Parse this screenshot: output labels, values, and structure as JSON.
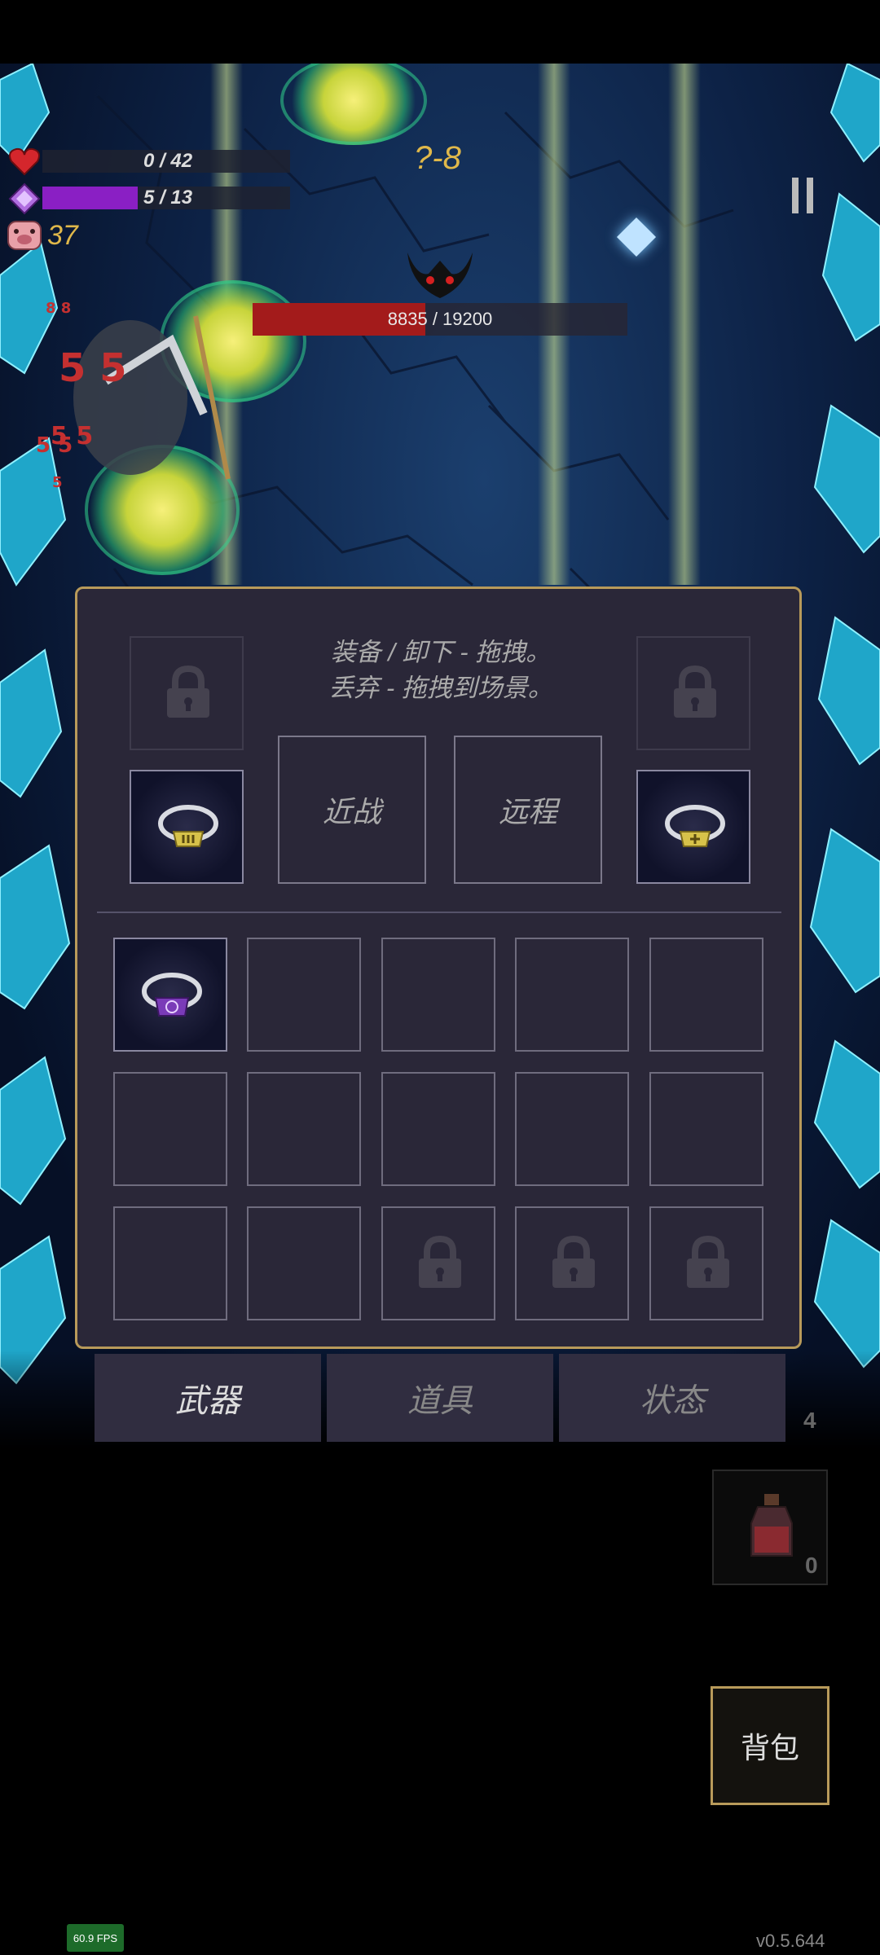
{
  "hud": {
    "hp_text": "0 / 42",
    "hp_fraction": 0,
    "mana_text": "5 / 13",
    "mana_fraction": 0.385,
    "coins": "37",
    "stage": "?-8"
  },
  "boss": {
    "hp_text": "8835 / 19200",
    "hp_fraction": 0.46
  },
  "damage_numbers": [
    "8 8",
    "5 5",
    "5 5",
    "5 5",
    "5"
  ],
  "inventory": {
    "hint_line1": "装备 / 卸下 - 拖拽。",
    "hint_line2": "丢弃 - 拖拽到场景。",
    "melee_label": "近战",
    "ranged_label": "远程",
    "grid": [
      [
        "ring-purple",
        "empty",
        "empty",
        "empty",
        "empty"
      ],
      [
        "empty",
        "empty",
        "empty",
        "empty",
        "empty"
      ],
      [
        "empty",
        "empty",
        "locked",
        "locked",
        "locked"
      ]
    ]
  },
  "tabs": {
    "weapon": "武器",
    "items": "道具",
    "status": "状态"
  },
  "side": {
    "gem_count": "4",
    "potion_count": "0"
  },
  "bag_label": "背包",
  "fps": "60.9 FPS",
  "version": "v0.5.644",
  "colors": {
    "panel_bg": "#2a2738",
    "panel_border": "#b89a5a",
    "hp_red": "#c62828",
    "mana_purple": "#8a1fc4",
    "boss_bar": "#a31b1b",
    "stage_gold": "#e0b84a"
  }
}
